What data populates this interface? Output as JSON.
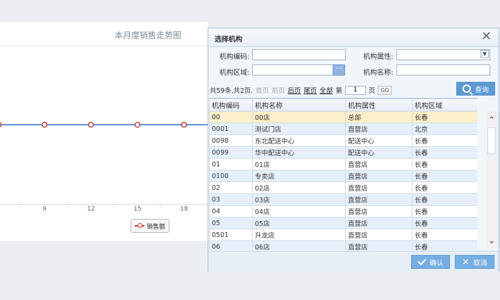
{
  "chart": {
    "title": "本月度销售走势图",
    "x_ticks": [
      "9",
      "12",
      "15",
      "18"
    ],
    "legend_label": "销售额",
    "line_color": "#5b8fd1",
    "marker_color": "#b33a3a"
  },
  "dialog": {
    "title": "选择机构",
    "close_symbol": "✕",
    "form": {
      "code_label": "机构编码:",
      "code_value": "",
      "attr_label": "机构属性:",
      "attr_value": "",
      "area_label": "机构区域:",
      "area_value": "",
      "area_button": "···",
      "name_label": "机构名称:",
      "name_value": ""
    },
    "pager": {
      "summary": "共59条,共2页.",
      "first": "首页",
      "prev": "前页",
      "next": "后页",
      "last": "尾页",
      "all": "全部",
      "page_prefix": "第",
      "page_value": "1",
      "page_suffix": "页",
      "go": "GO"
    },
    "query_button": "查询",
    "table": {
      "columns": [
        "机构编码",
        "机构名称",
        "机构属性",
        "机构区域"
      ],
      "rows": [
        [
          "00",
          "00店",
          "总部",
          "长春"
        ],
        [
          "0001",
          "测试门店",
          "直营店",
          "北京"
        ],
        [
          "0098",
          "东北配送中心",
          "配送中心",
          "长春"
        ],
        [
          "0099",
          "华中配送中心",
          "配送中心",
          "长春"
        ],
        [
          "01",
          "01店",
          "直营店",
          "长春"
        ],
        [
          "0100",
          "专卖店",
          "直营店",
          "长春"
        ],
        [
          "02",
          "02店",
          "直营店",
          "长春"
        ],
        [
          "03",
          "03店",
          "直营店",
          "长春"
        ],
        [
          "04",
          "04店",
          "直营店",
          "长春"
        ],
        [
          "05",
          "05店",
          "直营店",
          "长春"
        ],
        [
          "0501",
          "升龙店",
          "直营店",
          "长春"
        ],
        [
          "06",
          "06店",
          "直营店",
          "长春"
        ]
      ]
    },
    "confirm_button": "确认",
    "cancel_button": "取消"
  }
}
